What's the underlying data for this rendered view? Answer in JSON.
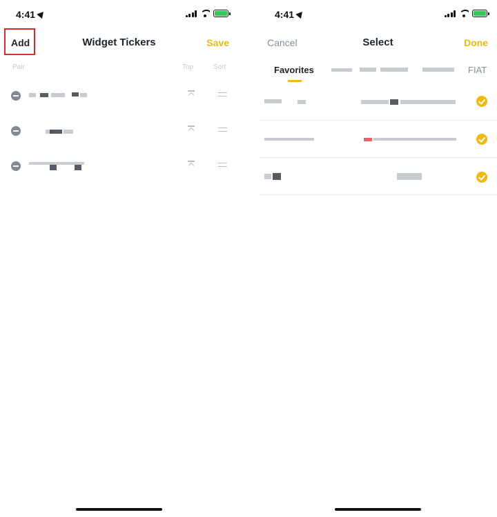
{
  "left_screen": {
    "status_time": "4:41",
    "nav": {
      "add_label": "Add",
      "title": "Widget Tickers",
      "save_label": "Save"
    },
    "columns": {
      "pair": "Pair",
      "top": "Top",
      "sort": "Sort"
    },
    "tickers": [
      {
        "pair": ""
      },
      {
        "pair": ""
      },
      {
        "pair": ""
      }
    ],
    "icons": [
      "remove-icon",
      "move-to-top-icon",
      "drag-handle-icon"
    ]
  },
  "right_screen": {
    "status_time": "4:41",
    "nav": {
      "cancel_label": "Cancel",
      "title": "Select",
      "done_label": "Done"
    },
    "tabs": {
      "favorites": "Favorites",
      "fiat": "FIAT"
    },
    "rows": [
      {
        "selected": true
      },
      {
        "selected": true
      },
      {
        "selected": true
      }
    ],
    "icons": [
      "check-icon"
    ]
  },
  "colors": {
    "accent": "#f0b90b",
    "highlight_border": "#e02828",
    "muted_text": "#848e9c",
    "battery": "#34c759"
  }
}
